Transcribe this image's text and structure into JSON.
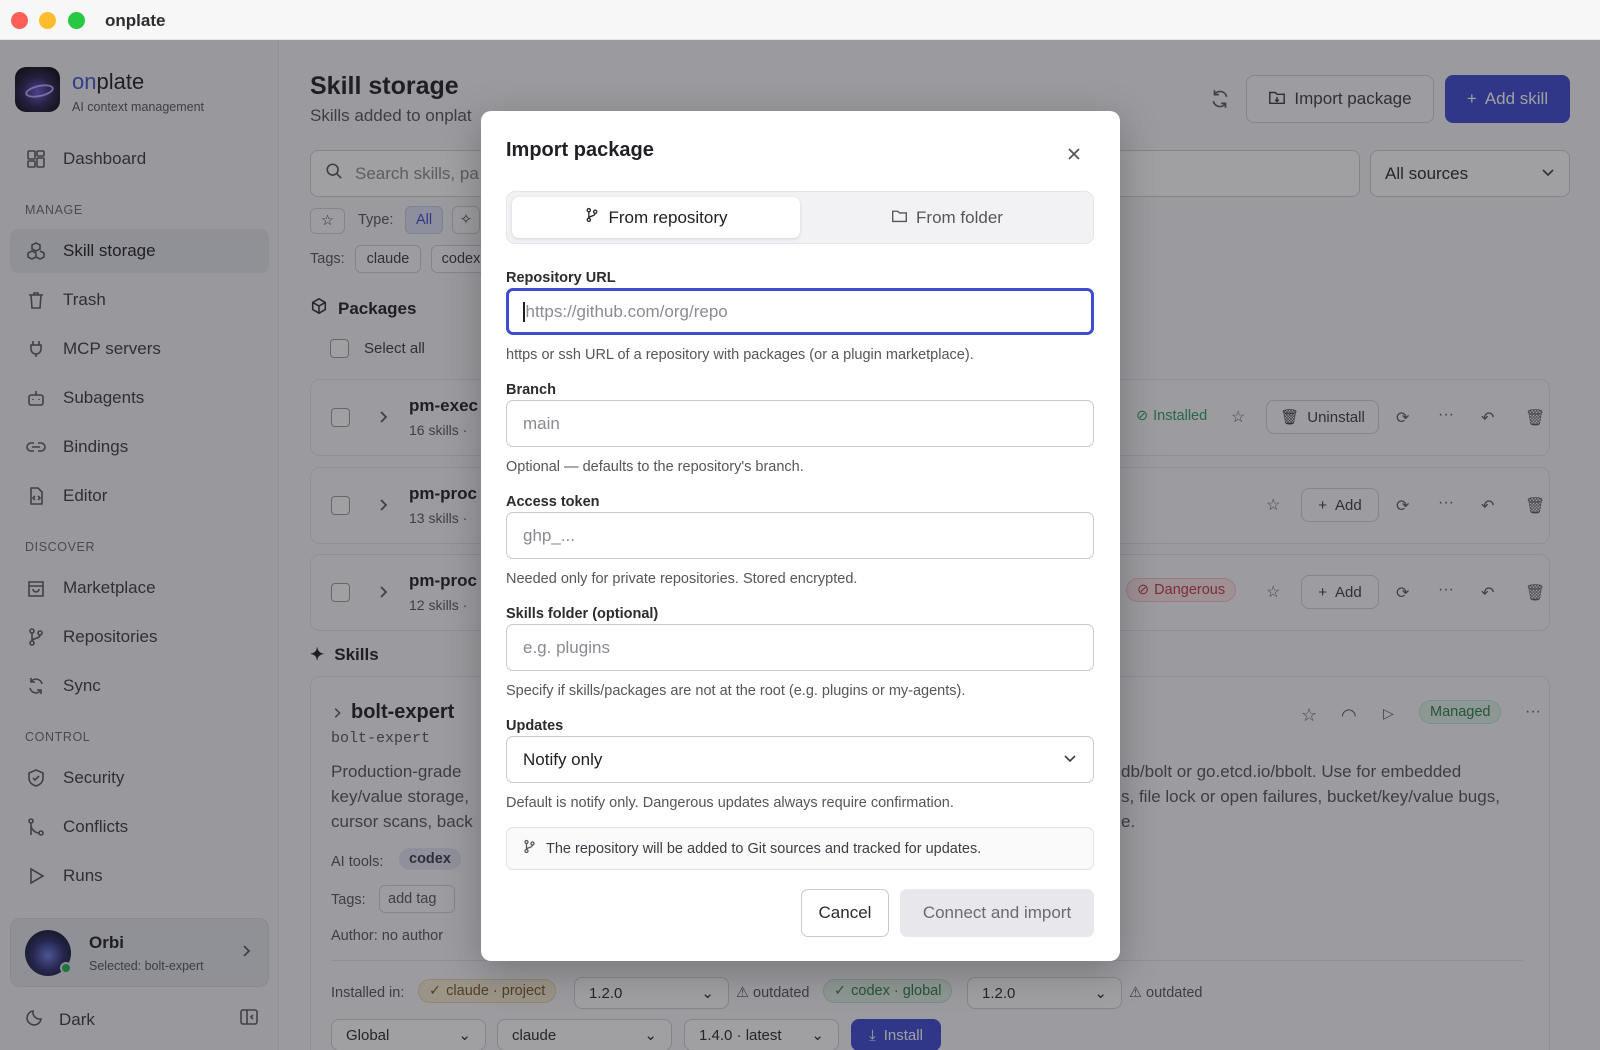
{
  "window": {
    "title": "onplate"
  },
  "brand": {
    "name_prefix": "on",
    "name_suffix": "plate",
    "subtitle": "AI context management"
  },
  "sidebar": {
    "dashboard": "Dashboard",
    "sections": {
      "manage": "MANAGE",
      "discover": "DISCOVER",
      "control": "CONTROL"
    },
    "items": {
      "skill_storage": "Skill storage",
      "trash": "Trash",
      "mcp_servers": "MCP servers",
      "subagents": "Subagents",
      "bindings": "Bindings",
      "editor": "Editor",
      "marketplace": "Marketplace",
      "repositories": "Repositories",
      "sync": "Sync",
      "security": "Security",
      "conflicts": "Conflicts",
      "runs": "Runs"
    },
    "user": {
      "name": "Orbi",
      "selected": "Selected: bolt-expert"
    },
    "theme": "Dark"
  },
  "main": {
    "title": "Skill storage",
    "subtitle": "Skills added to onplat",
    "import_button": "Import package",
    "add_button": "Add skill",
    "search_placeholder": "Search skills, pa",
    "sources_select": "All sources",
    "type_label": "Type:",
    "type_all": "All",
    "tags_label": "Tags:",
    "tags": [
      "claude",
      "codex"
    ],
    "packages_title": "Packages",
    "select_all": "Select all",
    "packages": [
      {
        "name": "pm-exec",
        "meta": "16 skills ·",
        "status": "Installed",
        "action": "Uninstall"
      },
      {
        "name": "pm-proc",
        "meta": "13 skills ·",
        "action": "Add"
      },
      {
        "name": "pm-proc",
        "meta": "12 skills ·",
        "status": "Dangerous",
        "action": "Add"
      }
    ],
    "skills_title": "Skills",
    "skill": {
      "name": "bolt-expert",
      "id": "bolt-expert",
      "badge": "Managed",
      "desc_left": [
        "Production-grade",
        "key/value storage,",
        "cursor scans, back"
      ],
      "desc_right": [
        "db/bolt or go.etcd.io/bbolt. Use for embedded",
        "s, file lock or open failures, bucket/key/value bugs,",
        "e."
      ],
      "ai_tools_label": "AI tools:",
      "ai_tool": "codex",
      "tags_label": "Tags:",
      "tag_placeholder": "add tag",
      "author": "Author: no author",
      "installed_in_label": "Installed in:",
      "installs": [
        {
          "target": "claude · project",
          "version": "1.2.0",
          "state": "outdated"
        },
        {
          "target": "codex · global",
          "version": "1.2.0",
          "state": "outdated"
        }
      ],
      "bottom_selects": [
        "Global",
        "claude",
        "1.4.0 · latest"
      ],
      "install_button": "Install"
    }
  },
  "modal": {
    "title": "Import package",
    "tabs": {
      "repo": "From repository",
      "folder": "From folder"
    },
    "repo_url": {
      "label": "Repository URL",
      "placeholder": "https://github.com/org/repo",
      "help": "https or ssh URL of a repository with packages (or a plugin marketplace)."
    },
    "branch": {
      "label": "Branch",
      "placeholder": "main",
      "help": "Optional — defaults to the repository's branch."
    },
    "token": {
      "label": "Access token",
      "placeholder": "ghp_...",
      "help": "Needed only for private repositories. Stored encrypted."
    },
    "folder": {
      "label": "Skills folder (optional)",
      "placeholder": "e.g. plugins",
      "help": "Specify if skills/packages are not at the root (e.g. plugins or my-agents)."
    },
    "updates": {
      "label": "Updates",
      "value": "Notify only",
      "help": "Default is notify only. Dangerous updates always require confirmation."
    },
    "note": "The repository will be added to Git sources and tracked for updates.",
    "cancel": "Cancel",
    "submit": "Connect and import"
  },
  "colors": {
    "accent": "#3f4bd1",
    "installed": "#2f9e5a",
    "dangerous": "#c4384a",
    "managed": "#2f7a4d"
  }
}
